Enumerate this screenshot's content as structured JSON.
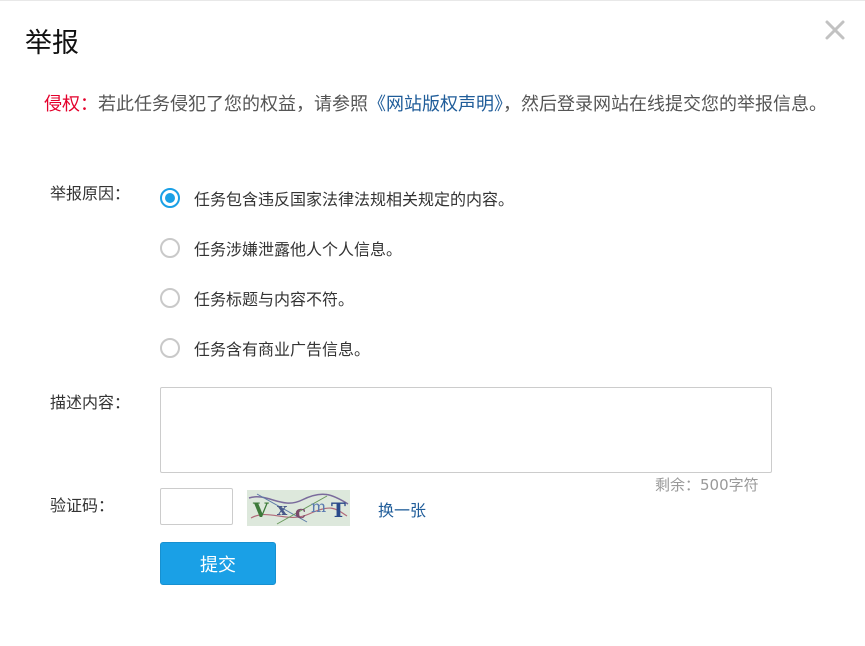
{
  "dialog": {
    "title": "举报",
    "close_icon": "close-icon"
  },
  "notice": {
    "warn_label": "侵权：",
    "text_before_link": "若此任务侵犯了您的权益，请参照",
    "link_text": "《网站版权声明》",
    "text_after_link": "，然后登录网站在线提交您的举报信息。",
    "warn_color": "#e4002b",
    "link_color": "#1f5c99"
  },
  "reason": {
    "label": "举报原因：",
    "selected_index": 0,
    "options": [
      "任务包含违反国家法律法规相关规定的内容。",
      "任务涉嫌泄露他人个人信息。",
      "任务标题与内容不符。",
      "任务含有商业广告信息。"
    ]
  },
  "description": {
    "label": "描述内容：",
    "value": "",
    "remaining": "剩余：500字符"
  },
  "captcha": {
    "label": "验证码：",
    "value": "",
    "refresh_label": "换一张"
  },
  "submit": {
    "label": "提交",
    "color": "#1aa0e6"
  }
}
